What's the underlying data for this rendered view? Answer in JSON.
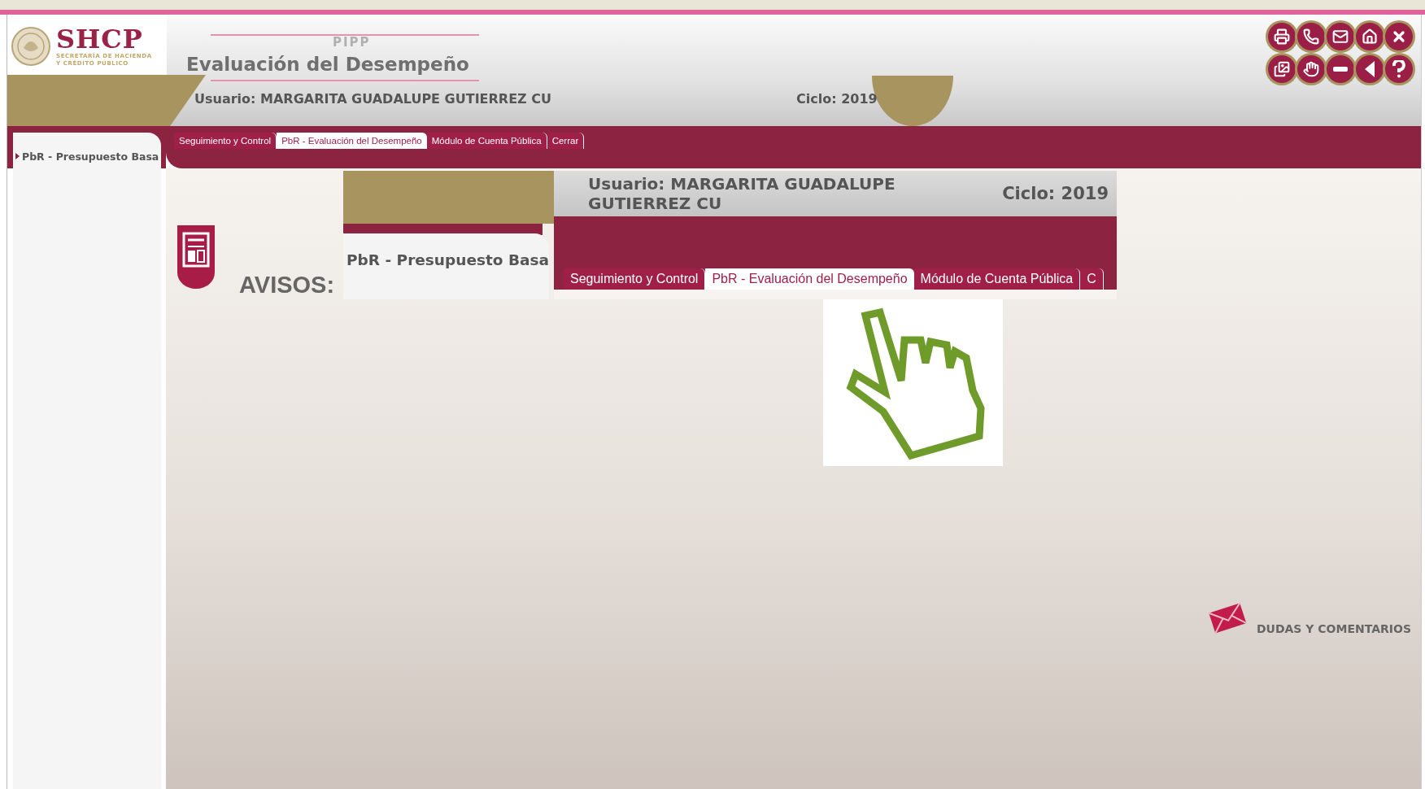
{
  "header": {
    "logo": {
      "acronym": "SHCP",
      "subtitle_lines": [
        "SECRETARÍA DE HACIENDA",
        "Y CRÉDITO PÚBLICO"
      ]
    },
    "app_mark": "PIPP",
    "title": "Evaluación del Desempeño",
    "user": "Usuario: MARGARITA GUADALUPE GUTIERREZ CU",
    "cycle": "Ciclo: 2019"
  },
  "toolbar": [
    {
      "kind": "print"
    },
    {
      "kind": "phone"
    },
    {
      "kind": "mail"
    },
    {
      "kind": "home"
    },
    {
      "kind": "close"
    },
    {
      "kind": "photos"
    },
    {
      "kind": "hand"
    },
    {
      "kind": "minus"
    },
    {
      "kind": "back"
    },
    {
      "kind": "help"
    }
  ],
  "tabs": [
    {
      "label": "Seguimiento y Control",
      "selected": false
    },
    {
      "label": "PbR - Evaluación del Desempeño",
      "selected": true
    },
    {
      "label": "Módulo de Cuenta Pública",
      "selected": false
    },
    {
      "label": "Cerrar",
      "selected": false
    }
  ],
  "sidebar": {
    "items": [
      {
        "label": "PbR - Presupuesto Basa"
      }
    ]
  },
  "notices": {
    "title": "AVISOS:"
  },
  "overlay": {
    "user": "Usuario: MARGARITA GUADALUPE GUTIERREZ CU",
    "cycle": "Ciclo: 2019",
    "sidebar_item": "PbR - Presupuesto Basa",
    "tabs": [
      {
        "label": "Seguimiento y Control",
        "selected": false
      },
      {
        "label": "PbR - Evaluación del Desempeño",
        "selected": true
      },
      {
        "label": "Módulo de Cuenta Pública",
        "selected": false
      },
      {
        "label": "C",
        "selected": false
      }
    ]
  },
  "feedback": {
    "label": "DUDAS Y COMENTARIOS"
  }
}
